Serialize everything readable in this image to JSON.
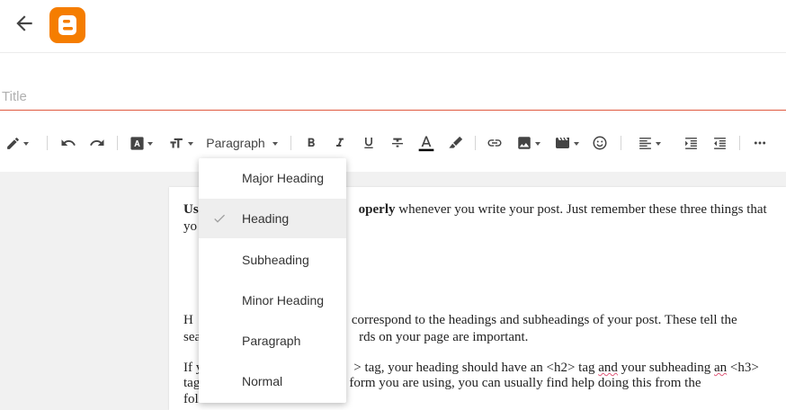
{
  "title": {
    "placeholder": "Title"
  },
  "toolbar": {
    "paragraph_label": "Paragraph"
  },
  "format_menu": {
    "items": [
      "Major Heading",
      "Heading",
      "Subheading",
      "Minor Heading",
      "Paragraph",
      "Normal"
    ],
    "selected": "Heading"
  },
  "content": {
    "p1_bold1": "Us",
    "p1_bold2": "operly",
    "p1_text": " whenever you write your post. Just remember these three things that",
    "p1_line2": "yo",
    "p2_start": "H",
    "p2_text": "correspond to the headings and subheadings of your post. These tell the",
    "p2_line2_start": "sea",
    "p2_line2_text": "rds on your page are important.",
    "p3_start": "If y",
    "p3_text": "> tag, your heading should have an <h2> tag ",
    "p3_and": "and",
    "p3_mid": " your subheading ",
    "p3_an": "an",
    "p3_end": " <h3>",
    "p3_line2_start": "tag",
    "p3_line2_text": "form you are using, you can usually find help doing this from the",
    "p3_line3_start": "fol"
  },
  "colors": {
    "brand": "#f57d00",
    "title_underline": "#e0593f",
    "menu_selected_bg": "#eeeeee"
  }
}
